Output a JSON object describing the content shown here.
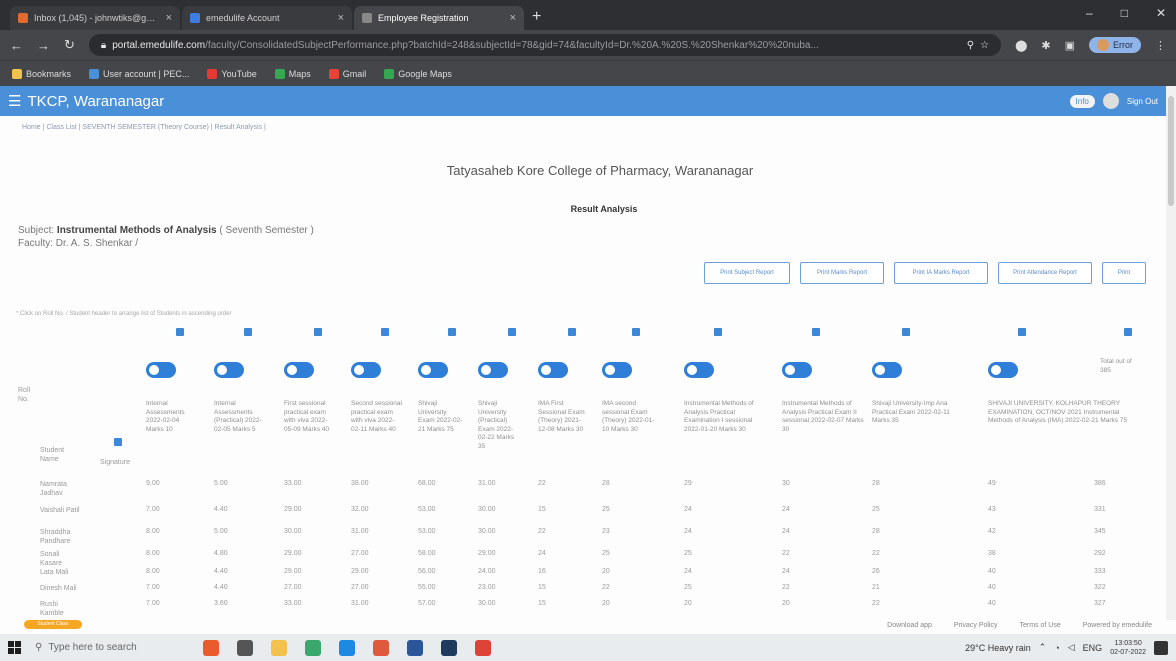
{
  "browser": {
    "tabs": [
      {
        "title": "Inbox (1,045) - johnwtiks@gmail",
        "active": false
      },
      {
        "title": "emedulife Account",
        "active": true
      },
      {
        "title": "Employee Registration",
        "active": false
      }
    ],
    "url_host": "portal.emedulife.com",
    "url_path": "/faculty/ConsolidatedSubjectPerformance.php?batchId=248&subjectId=78&gid=74&facultyId=Dr.%20A.%20S.%20Shenkar%20%20nuba...",
    "profile_label": "Error",
    "bookmarks": [
      "Bookmarks",
      "User account | PEC...",
      "YouTube",
      "Maps",
      "Gmail",
      "Google Maps"
    ]
  },
  "app": {
    "title": "TKCP, Warananagar",
    "badge": "Info",
    "user_label": "Sign Out",
    "breadcrumb": "Home  |  Class List  |  SEVENTH SEMESTER  (Theory Course)  |  Result Analysis  |",
    "college": "Tatyasaheb Kore College of Pharmacy, Warananagar",
    "page_heading": "Result Analysis",
    "subject_prefix": "Subject:",
    "subject_name": "Instrumental Methods of Analysis",
    "subject_suffix": "( Seventh Semester )",
    "faculty": "Faculty: Dr. A. S. Shenkar /",
    "buttons": [
      "Print Subject Report",
      "Print Marks Report",
      "Print IA Marks Report",
      "Print Attendance Report",
      "Print"
    ],
    "hint": "* Click on Roll No. / Student header to arrange list of Students in ascending order",
    "row_labels": {
      "roll": "Roll No.",
      "student": "Student Name",
      "signature": "Signature"
    },
    "columns": [
      "Internal Assessments 2022-02-04 Marks 10",
      "Internal Assessments (Practical) 2022-02-05 Marks 5",
      "First sessional practical exam with viva 2022-05-09 Marks 40",
      "Second sessional practical exam with viva 2022-02-11 Marks 40",
      "Shivaji University Exam 2022-02-21 Marks 75",
      "Shivaji University (Practical) Exam 2022-02-22 Marks 35",
      "IMA First Sessional Exam (Theory) 2021-12-08 Marks 30",
      "IMA second sessional Exam (Theory) 2022-01-10 Marks 30",
      "Instrumental Methods of Analysis Practical Examination I sessional 2022-01-20 Marks 30",
      "Instrumental Methods of Analysis Practical Exam II sessional 2022-02-07 Marks 30",
      "Shivaji University-Imp Ana Practical Exam 2022-02-11 Marks 35",
      "SHIVAJI UNIVERSITY, KOLHAPUR THEORY EXAMINATION, OCT/NOV 2021 Instrumental Methods of Analysis (IMA) 2022-02-21 Marks 75",
      "Total out of 385"
    ],
    "students": [
      {
        "name": "Namrata Jadhav",
        "marks": [
          "9.00",
          "5.00",
          "33.00",
          "38.00",
          "68.00",
          "31.00",
          "22",
          "28",
          "29",
          "30",
          "28",
          "49",
          "386"
        ]
      },
      {
        "name": "Vaishali Patil",
        "marks": [
          "7.00",
          "4.40",
          "29.00",
          "32.00",
          "53.00",
          "30.00",
          "15",
          "25",
          "24",
          "24",
          "25",
          "43",
          "331"
        ]
      },
      {
        "name": "Shraddha Pandhare",
        "marks": [
          "8.00",
          "5.00",
          "30.00",
          "31.00",
          "53.00",
          "30.00",
          "22",
          "23",
          "24",
          "24",
          "28",
          "42",
          "345"
        ]
      },
      {
        "name": "Sonali Kasare",
        "marks": [
          "8.00",
          "4.80",
          "29.00",
          "27.00",
          "58.00",
          "29.00",
          "24",
          "25",
          "25",
          "22",
          "22",
          "38",
          "292"
        ]
      },
      {
        "name": "Lata Mali",
        "marks": [
          "8.00",
          "4.40",
          "29.00",
          "29.00",
          "56.00",
          "24.00",
          "16",
          "20",
          "24",
          "24",
          "26",
          "40",
          "333"
        ]
      },
      {
        "name": "Dinesh Mali",
        "marks": [
          "7.00",
          "4.40",
          "27.00",
          "27.00",
          "55.00",
          "23.00",
          "15",
          "22",
          "25",
          "22",
          "21",
          "40",
          "322"
        ]
      },
      {
        "name": "Rushi Kamble",
        "marks": [
          "7.00",
          "3.60",
          "33.00",
          "31.00",
          "57.00",
          "30.00",
          "15",
          "20",
          "20",
          "20",
          "22",
          "40",
          "327"
        ]
      }
    ],
    "footer": [
      "Download app",
      "Privacy Policy",
      "Terms of Use",
      "Powered by emedulife"
    ],
    "pill": "Student Class Announcement"
  },
  "taskbar": {
    "search": "Type here to search",
    "weather": "29°C  Heavy rain",
    "lang": "ENG",
    "time": "13:03:50",
    "date": "02-07-2022"
  },
  "colors": {
    "app_bar": "#4a90d9",
    "accent": "#2f7fd8",
    "chrome_dark": "#2e2f33"
  }
}
